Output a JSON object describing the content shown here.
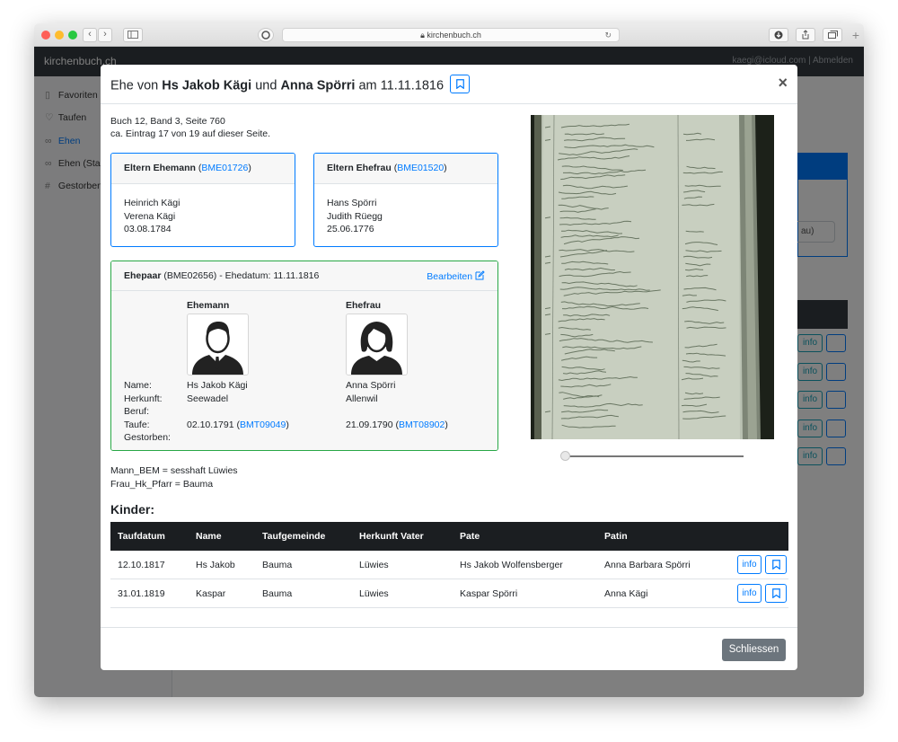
{
  "browser": {
    "url": "kirchenbuch.ch"
  },
  "app": {
    "brand": "kirchenbuch.ch",
    "user_links": "kaegi@icloud.com | Abmelden",
    "sidebar": [
      {
        "label": "Favoriten",
        "icon": "bookmark-icon"
      },
      {
        "label": "Taufen",
        "icon": "tag-icon"
      },
      {
        "label": "Ehen",
        "icon": "link-icon",
        "active": true
      },
      {
        "label": "Ehen (StaZ",
        "icon": "link-icon"
      },
      {
        "label": "Gestorben",
        "icon": "hash-icon"
      }
    ],
    "background_input_fragment": "au)",
    "background_info_label": "info"
  },
  "modal": {
    "title_prefix": "Ehe von",
    "groom": "Hs Jakob Kägi",
    "title_and": "und",
    "bride": "Anna Spörri",
    "title_date_prefix": "am",
    "date": "11.11.1816",
    "close_symbol": "×",
    "source_line1": "Buch 12, Band 3, Seite 760",
    "source_line2": "ca. Eintrag 17 von 19 auf dieser Seite.",
    "parents_groom": {
      "title": "Eltern Ehemann",
      "id": "BME01726",
      "father": "Heinrich Kägi",
      "mother": "Verena Kägi",
      "date": "03.08.1784"
    },
    "parents_bride": {
      "title": "Eltern Ehefrau",
      "id": "BME01520",
      "father": "Hans Spörri",
      "mother": "Judith Rüegg",
      "date": "25.06.1776"
    },
    "couple": {
      "title": "Ehepaar",
      "id_text": "(BME02656)",
      "marriage_label": "- Ehedatum: 11.11.1816",
      "edit_label": "Bearbeiten",
      "husband_label": "Ehemann",
      "wife_label": "Ehefrau",
      "labels": {
        "name": "Name:",
        "origin": "Herkunft:",
        "job": "Beruf:",
        "baptism": "Taufe:",
        "died": "Gestorben:"
      },
      "husband": {
        "name": "Hs Jakob Kägi",
        "origin": "Seewadel",
        "job": "",
        "baptism_date": "02.10.1791",
        "baptism_id": "BMT09049",
        "died": ""
      },
      "wife": {
        "name": "Anna Spörri",
        "origin": "Allenwil",
        "job": "",
        "baptism_date": "21.09.1790",
        "baptism_id": "BMT08902",
        "died": ""
      }
    },
    "notes": [
      "Mann_BEM = sesshaft Lüwies",
      "Frau_Hk_Pfarr = Bauma"
    ],
    "children_title": "Kinder:",
    "table": {
      "headers": [
        "Taufdatum",
        "Name",
        "Taufgemeinde",
        "Herkunft Vater",
        "Pate",
        "Patin"
      ],
      "rows": [
        [
          "12.10.1817",
          "Hs Jakob",
          "Bauma",
          "Lüwies",
          "Hs Jakob Wolfensberger",
          "Anna Barbara Spörri"
        ],
        [
          "31.01.1819",
          "Kaspar",
          "Bauma",
          "Lüwies",
          "Kaspar Spörri",
          "Anna Kägi"
        ]
      ],
      "info_label": "info"
    },
    "footer_close": "Schliessen",
    "slider_value": 0
  },
  "colors": {
    "primary": "#007bff",
    "success": "#28a745",
    "dark": "#1b1e21",
    "secondary": "#6c757d",
    "navbar": "#343a40"
  }
}
